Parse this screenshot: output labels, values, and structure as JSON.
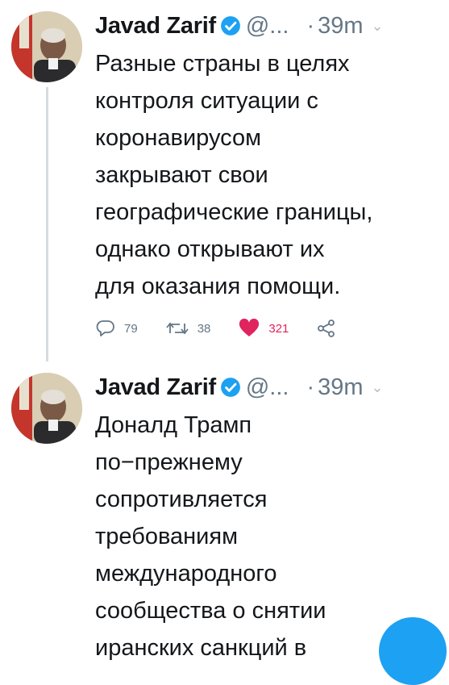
{
  "tweets": [
    {
      "author_name": "Javad Zarif",
      "handle": "@...",
      "separator": "·",
      "time": "39m",
      "text_lines": [
        "Разные страны в целях",
        "контроля ситуации с",
        "коронавирусом",
        "закрывают свои",
        "географические границы,",
        "однако открывают их",
        "для оказания помощи."
      ],
      "actions": {
        "reply_count": "79",
        "retweet_count": "38",
        "like_count": "321"
      }
    },
    {
      "author_name": "Javad Zarif",
      "handle": "@...",
      "separator": "·",
      "time": "39m",
      "text_lines": [
        "Доналд Трамп",
        "по−прежнему",
        "сопротивляется",
        "требованиям",
        "международного",
        "сообщества о снятии",
        "иранских санкций в"
      ]
    }
  ],
  "icons": {
    "verified": "verified-badge-icon",
    "reply": "reply-icon",
    "retweet": "retweet-icon",
    "like": "heart-icon",
    "share": "share-icon",
    "more": "chevron-down-icon"
  },
  "colors": {
    "accent": "#1da1f2",
    "like": "#e0245e",
    "secondary_text": "#657786"
  }
}
